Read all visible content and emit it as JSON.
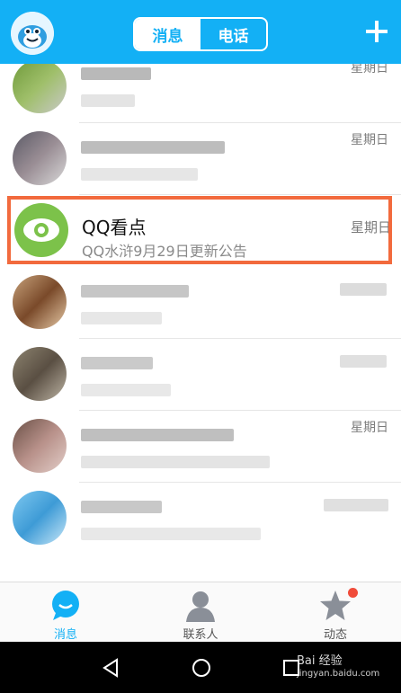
{
  "header": {
    "tabs": [
      {
        "label": "消息",
        "active": true
      },
      {
        "label": "电话",
        "active": false
      }
    ],
    "add_icon": "plus-icon"
  },
  "rows": [
    {
      "date": "星期日"
    },
    {
      "date": "星期日"
    },
    {
      "title": "QQ看点",
      "subtitle": "QQ水浒9月29日更新公告",
      "date": "星期日",
      "highlighted": true
    },
    {
      "date": ""
    },
    {
      "date": ""
    },
    {
      "date": "星期日"
    },
    {
      "date": ""
    }
  ],
  "bottom_nav": [
    {
      "label": "消息",
      "icon": "message-bubble-icon",
      "active": true
    },
    {
      "label": "联系人",
      "icon": "contacts-person-icon",
      "active": false
    },
    {
      "label": "动态",
      "icon": "star-icon",
      "active": false,
      "badge": true
    }
  ],
  "watermark": {
    "line1": "Bai 经验",
    "line2": "jingyan.baidu.com"
  },
  "colors": {
    "header": "#13b0f5",
    "highlight_border": "#f26a3d",
    "qq_kandian_green": "#7cc24a",
    "active_nav": "#13b0f5"
  }
}
